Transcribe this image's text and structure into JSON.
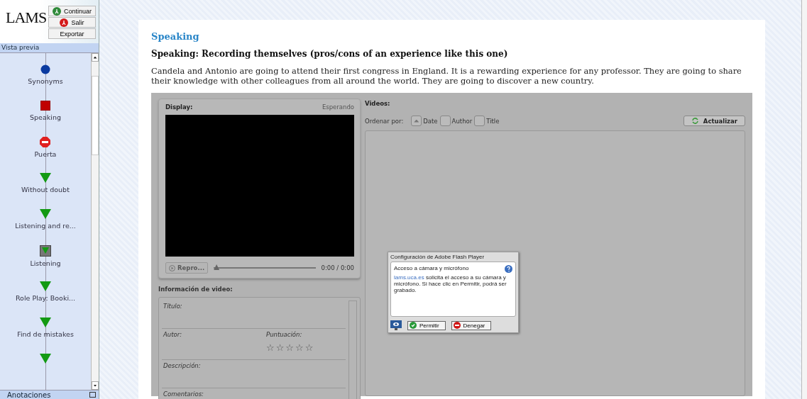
{
  "sidebar": {
    "logo": "LAMS",
    "buttons": [
      {
        "label": "Continuar",
        "kind": "go"
      },
      {
        "label": "Salir",
        "kind": "exit"
      },
      {
        "label": "Exportar",
        "kind": "plain"
      }
    ],
    "preview_title": "Vista previa",
    "items": [
      {
        "label": "Synonyms",
        "kind": "circle"
      },
      {
        "label": "Speaking",
        "kind": "square"
      },
      {
        "label": "Puerta",
        "kind": "stop"
      },
      {
        "label": "Without doubt",
        "kind": "triangle"
      },
      {
        "label": "Listening and re...",
        "kind": "triangle"
      },
      {
        "label": "Listening",
        "kind": "boxed"
      },
      {
        "label": "Role Play: Booki...",
        "kind": "triangle"
      },
      {
        "label": "Find de mistakes",
        "kind": "triangle"
      },
      {
        "kind": "triangle"
      }
    ],
    "notes_title": "Anotaciones"
  },
  "activity": {
    "heading": "Speaking",
    "title": "Speaking: Recording themselves (pros/cons of an experience like this one)",
    "text": "Candela and Antonio are going to attend their first congress in England. It is a rewarding experience for any professor. They are going to share their knowledge with other colleagues from all around the world. They are going to discover a new country."
  },
  "recorder": {
    "display_label": "Display:",
    "status": "Esperando",
    "play_button": "Repro...",
    "seek": {
      "level": 0
    },
    "time": "0:00 / 0:00",
    "info_title": "Información de video:",
    "fields": [
      {
        "label": "Título:"
      },
      {
        "label": "Autor:",
        "rating_label": "Puntuación:",
        "stars": 0
      },
      {
        "label": "Descripción:"
      },
      {
        "label": "Comentarios:"
      }
    ],
    "videos_label": "Videos:",
    "sort_label": "Ordenar por:",
    "sort_options": [
      {
        "label": "Date",
        "selected": true
      },
      {
        "label": "Author",
        "selected": false
      },
      {
        "label": "Title",
        "selected": false
      }
    ],
    "refresh_button": "Actualizar"
  },
  "flash_dialog": {
    "title": "Configuración de Adobe Flash Player",
    "heading": "Acceso a cámara y micrófono",
    "link": "lams.uca.es",
    "text": " solicita el acceso a su cámara y micrófono. Si hace clic en Permitir, podrá ser grabado.",
    "allow": "Permitir",
    "deny": "Denegar"
  }
}
